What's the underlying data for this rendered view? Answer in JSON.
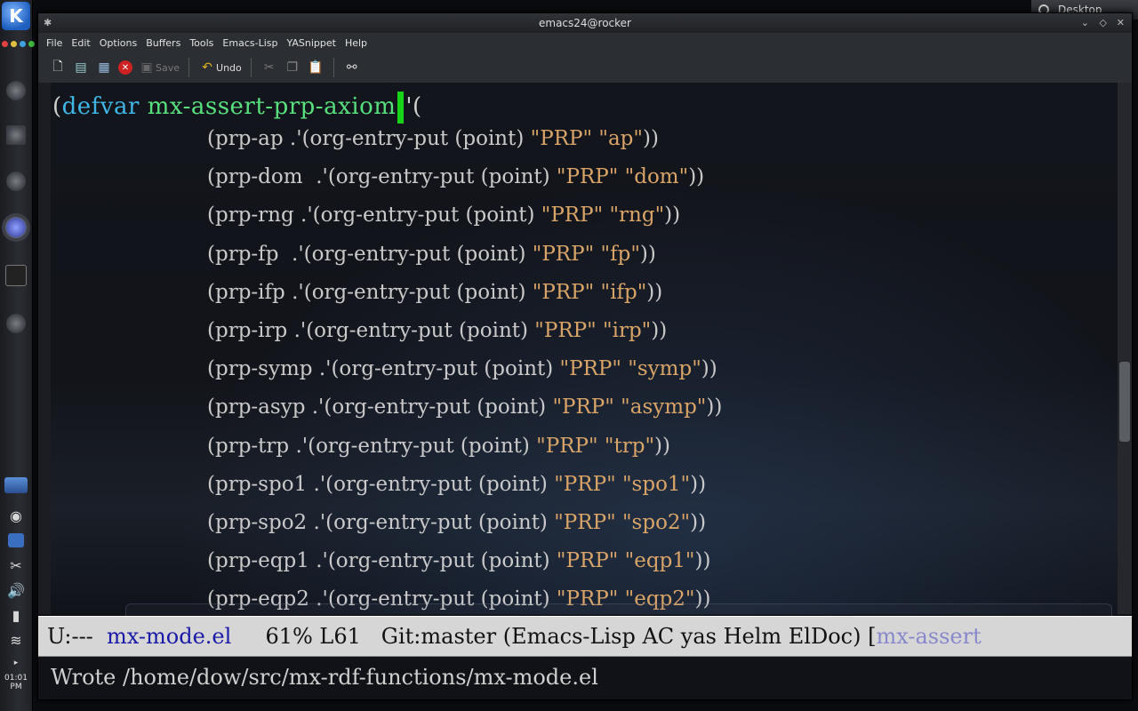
{
  "window": {
    "title": "emacs24@rocker"
  },
  "desktop_button": {
    "label": "Desktop"
  },
  "kde_panel": {
    "clock": "01:01 PM"
  },
  "menu": [
    "File",
    "Edit",
    "Options",
    "Buffers",
    "Tools",
    "Emacs-Lisp",
    "YASnippet",
    "Help"
  ],
  "toolbar": {
    "save_label": "Save",
    "undo_label": "Undo"
  },
  "editor": {
    "defvar_keyword": "defvar",
    "defvar_name": "mx-assert-prp-axiom",
    "defvar_open": "(",
    "defvar_tail": "'(",
    "entries": [
      {
        "sym": "(prp-ap",
        "dot": " .",
        "body": "'(org-entry-put (point) ",
        "k": "\"PRP\"",
        "v": " \"ap\"",
        "close": "))"
      },
      {
        "sym": "(prp-dom",
        "dot": "  .",
        "body": "'(org-entry-put (point) ",
        "k": "\"PRP\"",
        "v": " \"dom\"",
        "close": "))"
      },
      {
        "sym": "(prp-rng",
        "dot": " .",
        "body": "'(org-entry-put (point) ",
        "k": "\"PRP\"",
        "v": " \"rng\"",
        "close": "))"
      },
      {
        "sym": "(prp-fp",
        "dot": "  .",
        "body": "'(org-entry-put (point) ",
        "k": "\"PRP\"",
        "v": " \"fp\"",
        "close": "))"
      },
      {
        "sym": "(prp-ifp",
        "dot": " .",
        "body": "'(org-entry-put (point) ",
        "k": "\"PRP\"",
        "v": " \"ifp\"",
        "close": "))"
      },
      {
        "sym": "(prp-irp",
        "dot": " .",
        "body": "'(org-entry-put (point) ",
        "k": "\"PRP\"",
        "v": " \"irp\"",
        "close": "))"
      },
      {
        "sym": "(prp-symp",
        "dot": " .",
        "body": "'(org-entry-put (point) ",
        "k": "\"PRP\"",
        "v": " \"symp\"",
        "close": "))"
      },
      {
        "sym": "(prp-asyp",
        "dot": " .",
        "body": "'(org-entry-put (point) ",
        "k": "\"PRP\"",
        "v": " \"asymp\"",
        "close": "))"
      },
      {
        "sym": "(prp-trp",
        "dot": " .",
        "body": "'(org-entry-put (point) ",
        "k": "\"PRP\"",
        "v": " \"trp\"",
        "close": "))"
      },
      {
        "sym": "(prp-spo1",
        "dot": " .",
        "body": "'(org-entry-put (point) ",
        "k": "\"PRP\"",
        "v": " \"spo1\"",
        "close": "))"
      },
      {
        "sym": "(prp-spo2",
        "dot": " .",
        "body": "'(org-entry-put (point) ",
        "k": "\"PRP\"",
        "v": " \"spo2\"",
        "close": "))"
      },
      {
        "sym": "(prp-eqp1",
        "dot": " .",
        "body": "'(org-entry-put (point) ",
        "k": "\"PRP\"",
        "v": " \"eqp1\"",
        "close": "))"
      },
      {
        "sym": "(prp-eqp2",
        "dot": " .",
        "body": "'(org-entry-put (point) ",
        "k": "\"PRP\"",
        "v": " \"eqp2\"",
        "close": "))"
      }
    ]
  },
  "modeline": {
    "status": "U:---  ",
    "buffer": "mx-mode.el",
    "position": "     61% L61   ",
    "vc": "Git:master ",
    "modes": "(Emacs-Lisp AC yas Helm ElDoc) [",
    "which_func": "mx-assert"
  },
  "echo": {
    "message": "Wrote /home/dow/src/mx-rdf-functions/mx-mode.el"
  }
}
